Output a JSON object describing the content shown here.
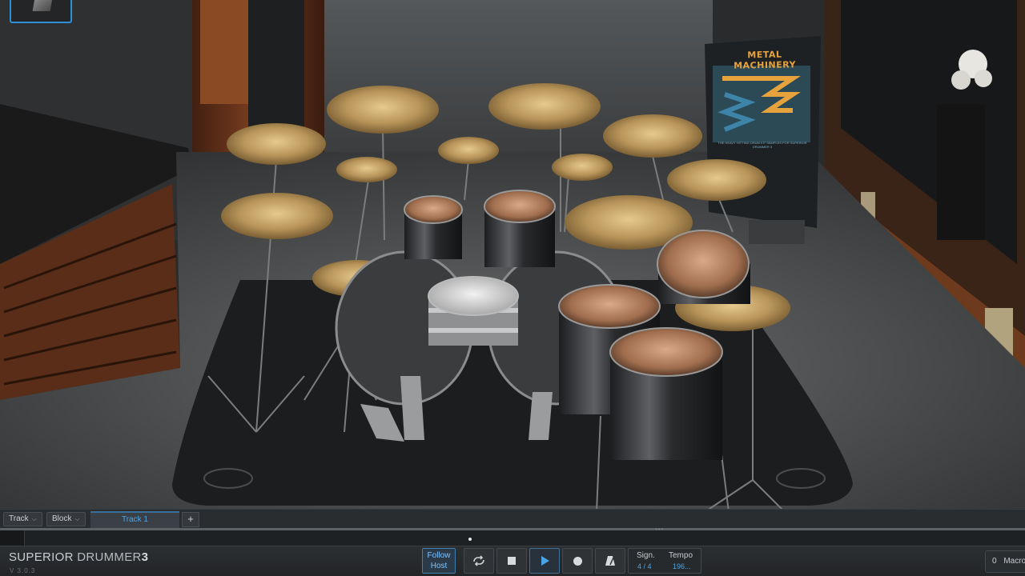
{
  "app": {
    "logo_part1": "SUPERIOR",
    "logo_part2": "DRUMMER",
    "logo_part3": "3",
    "version": "V 3.0.3"
  },
  "stage": {
    "banner_title": "METAL MACHINERY",
    "banner_subtitle": "THE HEAVY HITTING DRUM KIT SAMPLES FOR SUPERIOR DRUMMER 3"
  },
  "trackbar": {
    "track_label": "Track",
    "block_label": "Block",
    "active_tab": "Track 1",
    "add_label": "+"
  },
  "transport": {
    "follow_host_line1": "Follow",
    "follow_host_line2": "Host",
    "signature_label": "Sign.",
    "signature_value": "4 / 4",
    "tempo_label": "Tempo",
    "tempo_value": "196...",
    "macro_count": "0",
    "macro_label": "Macro"
  },
  "colors": {
    "accent": "#2e8fd6",
    "active_text": "#4aa5e6",
    "banner_orange": "#e6a23c"
  },
  "icons": [
    "cube-icon",
    "chevron-down-icon",
    "plus-icon",
    "loop-icon",
    "stop-icon",
    "play-icon",
    "record-icon",
    "metronome-icon"
  ]
}
